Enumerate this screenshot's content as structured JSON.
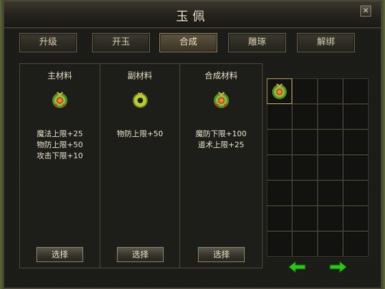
{
  "window": {
    "title": "玉佩",
    "close_glyph": "✕"
  },
  "tabs": [
    {
      "label": "升级",
      "active": false
    },
    {
      "label": "开玉",
      "active": false
    },
    {
      "label": "合成",
      "active": true
    },
    {
      "label": "雕琢",
      "active": false
    },
    {
      "label": "解绑",
      "active": false
    }
  ],
  "columns": [
    {
      "title": "主材料",
      "icon": "jade-pendant-red-icon",
      "stats": [
        "魔法上限+25",
        "物防上限+50",
        "攻击下限+10"
      ],
      "button": "选择"
    },
    {
      "title": "副材料",
      "icon": "jade-ring-green-icon",
      "stats": [
        "物防上限+50"
      ],
      "button": "选择"
    },
    {
      "title": "合成材料",
      "icon": "jade-pendant-red-icon",
      "stats": [
        "魔防下限+100",
        "道术上限+25"
      ],
      "button": "选择"
    }
  ],
  "inventory": {
    "rows": 7,
    "cols": 4,
    "filled_slots": [
      0
    ],
    "item_icon": "jade-pendant-red-icon"
  },
  "pager": {
    "prev_icon": "green-arrow-left-icon",
    "next_icon": "green-arrow-right-icon"
  },
  "colors": {
    "arrow": "#2fc41a",
    "text": "#ece5cf",
    "frame": "#4d493c"
  }
}
